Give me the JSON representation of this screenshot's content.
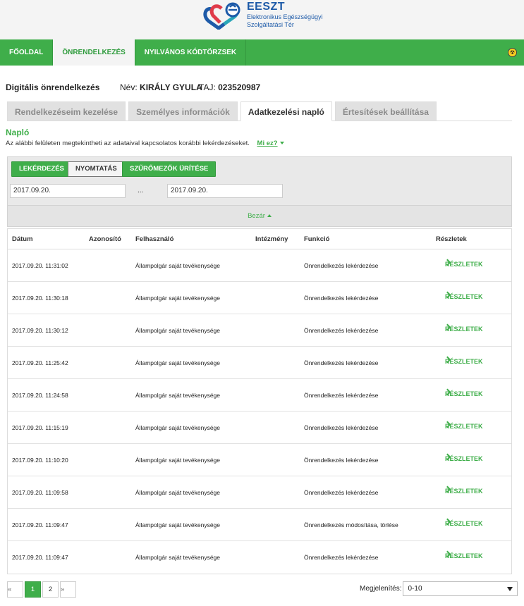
{
  "header": {
    "logo_title": "EESZT",
    "logo_sub1": "Elektronikus Egészségügyi",
    "logo_sub2": "Szolgáltatási Tér"
  },
  "nav": {
    "items": [
      {
        "label": "FŐOLDAL",
        "active": false
      },
      {
        "label": "ÖNRENDELKEZÉS",
        "active": true
      },
      {
        "label": "NYILVÁNOS KÓDTÖRZSEK",
        "active": false
      }
    ],
    "warn_icon": "radiation-icon"
  },
  "info": {
    "page_title": "Digitális önrendelkezés",
    "name_label": "Név:",
    "name_value": "KIRÁLY GYULA",
    "taj_label": "TAJ:",
    "taj_value": "023520987"
  },
  "tabs": [
    {
      "label": "Rendelkezéseim kezelése",
      "active": false
    },
    {
      "label": "Személyes információk",
      "active": false
    },
    {
      "label": "Adatkezelési napló",
      "active": true
    },
    {
      "label": "Értesítések beállítása",
      "active": false
    }
  ],
  "section": {
    "title": "Napló",
    "description": "Az alábbi felületen megtekintheti az adataival kapcsolatos korábbi lekérdezéseket.",
    "whatis_link": "Mi ez?"
  },
  "filter": {
    "query_button": "LEKÉRDEZÉS",
    "print_button": "NYOMTATÁS",
    "clear_button": "SZŰRŐMEZŐK ÜRÍTÉSE",
    "date_from": "2017.09.20.",
    "date_to": "2017.09.20.",
    "separator": "...",
    "close_label": "Bezár"
  },
  "table": {
    "headers": {
      "date": "Dátum",
      "id": "Azonosító",
      "user": "Felhasználó",
      "institution": "Intézmény",
      "function": "Funkció",
      "details": "Részletek"
    },
    "detail_label": "RÉSZLETEK",
    "rows": [
      {
        "date": "2017.09.20. 11:31:02",
        "user": "Állampolgár saját tevékenysége",
        "function": "Önrendelkezés lekérdezése"
      },
      {
        "date": "2017.09.20. 11:30:18",
        "user": "Állampolgár saját tevékenysége",
        "function": "Önrendelkezés lekérdezése"
      },
      {
        "date": "2017.09.20. 11:30:12",
        "user": "Állampolgár saját tevékenysége",
        "function": "Önrendelkezés lekérdezése"
      },
      {
        "date": "2017.09.20. 11:25:42",
        "user": "Állampolgár saját tevékenysége",
        "function": "Önrendelkezés lekérdezése"
      },
      {
        "date": "2017.09.20. 11:24:58",
        "user": "Állampolgár saját tevékenysége",
        "function": "Önrendelkezés lekérdezése"
      },
      {
        "date": "2017.09.20. 11:15:19",
        "user": "Állampolgár saját tevékenysége",
        "function": "Önrendelkezés lekérdezése"
      },
      {
        "date": "2017.09.20. 11:10:20",
        "user": "Állampolgár saját tevékenysége",
        "function": "Önrendelkezés lekérdezése"
      },
      {
        "date": "2017.09.20. 11:09:58",
        "user": "Állampolgár saját tevékenysége",
        "function": "Önrendelkezés lekérdezése"
      },
      {
        "date": "2017.09.20. 11:09:47",
        "user": "Állampolgár saját tevékenysége",
        "function": "Önrendelkezés módosítása, törlése"
      },
      {
        "date": "2017.09.20. 11:09:47",
        "user": "Állampolgár saját tevékenysége",
        "function": "Önrendelkezés lekérdezése"
      }
    ]
  },
  "pagination": {
    "prev": "«",
    "pages": [
      "1",
      "2"
    ],
    "current": "1",
    "next": "»",
    "show_label": "Megjelenítés:",
    "show_value": "0-10"
  },
  "colors": {
    "brand_green": "#3fae4a",
    "brand_blue": "#1d5aa8"
  }
}
